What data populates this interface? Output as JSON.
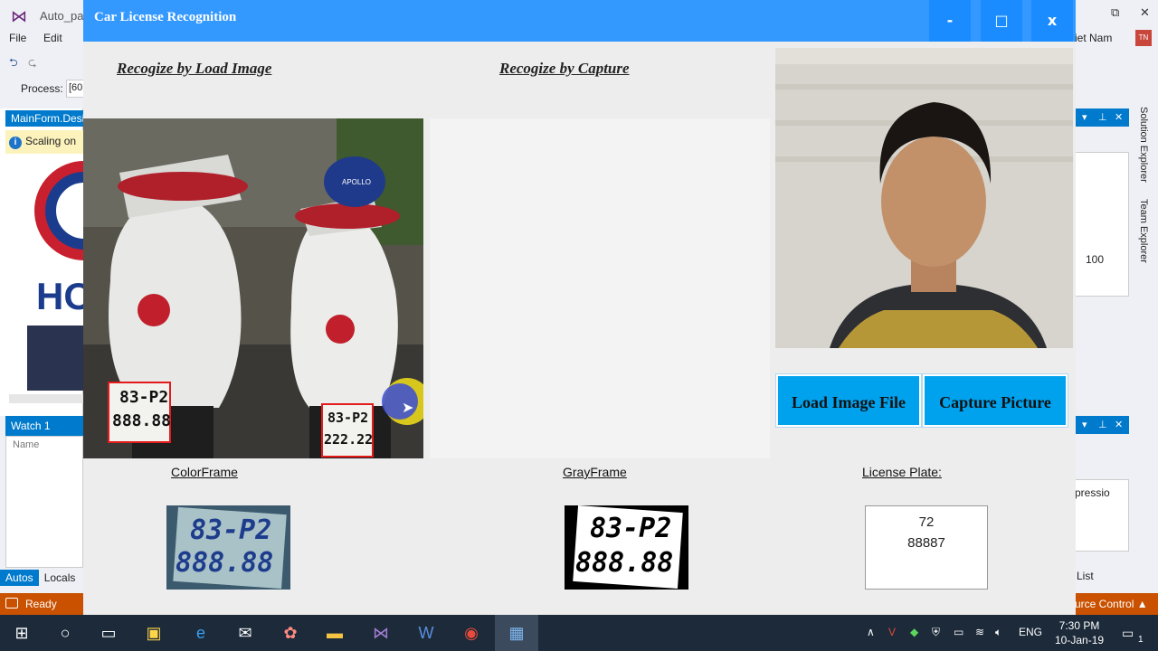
{
  "vs": {
    "title": "Auto_par",
    "menu": [
      "File",
      "Edit"
    ],
    "process_label": "Process:",
    "process_value": "[60",
    "designer_tab": "MainForm.Desi",
    "info_bar": "Scaling on",
    "logo_text": "HO",
    "watch_tab": "Watch 1",
    "watch_column": "Name",
    "bottom_tabs": [
      "Autos",
      "Locals"
    ],
    "status_ready": "Ready",
    "status_right": "urce Control",
    "lang": "iet Nam",
    "avatar": "TN",
    "props_value": "100",
    "expression": "pressio",
    "list_tab": "List",
    "solution_explorer": "Solution Explorer",
    "team_explorer": "Team Explorer"
  },
  "app": {
    "title": "Car License Recognition",
    "minimize": "-",
    "maximize": "□",
    "close": "x",
    "section_load": "Recogize by Load Image",
    "section_capture": "Recogize by Capture",
    "load_button": "Load Image File",
    "capture_button": "Capture Picture",
    "color_frame_label": "ColorFrame",
    "gray_frame_label": "GrayFrame",
    "license_plate_label": "License Plate:",
    "plate_line1": "72",
    "plate_line2": "88887",
    "scooter_plate_left": [
      "83-P2",
      "888.88"
    ],
    "scooter_plate_right": [
      "83-P2",
      "222.22"
    ],
    "helmet_text": "APOLLO",
    "color_frame_plate": [
      "83-P2",
      "888.88"
    ],
    "gray_frame_plate": [
      "83-P2",
      "888.88"
    ]
  },
  "taskbar": {
    "lang": "ENG",
    "time": "7:30 PM",
    "date": "10-Jan-19",
    "notifications": "1"
  },
  "colors": {
    "titlebar": "#3399ff",
    "button": "#00a2ed",
    "status": "#ca5100",
    "vs_accent": "#007acc"
  }
}
